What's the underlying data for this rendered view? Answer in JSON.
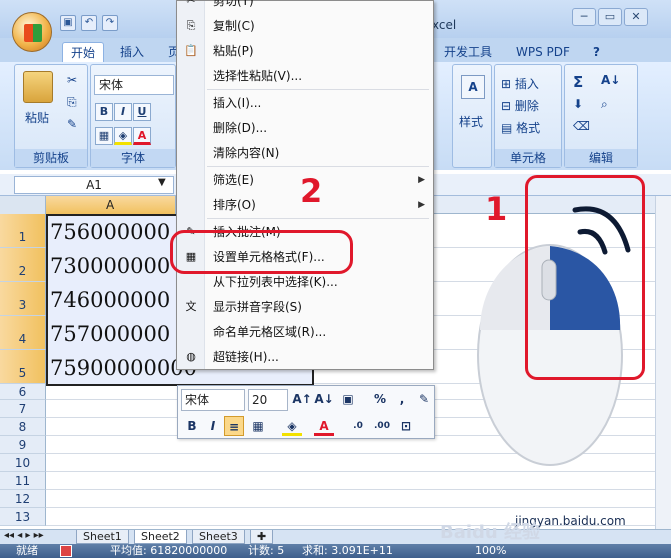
{
  "title": {
    "app_suffix": "xcel"
  },
  "ribbon_tabs": [
    "开始",
    "插入",
    "页",
    "开发工具",
    "WPS PDF"
  ],
  "ribbon": {
    "paste_label": "粘贴",
    "clipboard_group": "剪贴板",
    "font_name": "宋体",
    "font_group": "字体",
    "style_label": "样式",
    "cells": {
      "insert": "插入",
      "delete": "删除",
      "format": "格式",
      "group": "单元格"
    },
    "edit_group": "编辑",
    "bold": "B",
    "italic": "I",
    "underline": "U"
  },
  "namebox": "A1",
  "column_header": "A",
  "rows": [
    "1",
    "2",
    "3",
    "4",
    "5",
    "6",
    "7",
    "8",
    "9",
    "10",
    "11",
    "12",
    "13"
  ],
  "cell_values": [
    "756000000",
    "730000000",
    "746000000",
    "757000000",
    "75900000000"
  ],
  "context_menu": {
    "items": [
      {
        "label": "剪切(T)",
        "icon": "scissors-icon"
      },
      {
        "label": "复制(C)",
        "icon": "copy-icon"
      },
      {
        "label": "粘贴(P)",
        "icon": "paste-icon"
      },
      {
        "label": "选择性粘贴(V)...",
        "icon": ""
      },
      {
        "label": "插入(I)...",
        "icon": ""
      },
      {
        "label": "删除(D)...",
        "icon": ""
      },
      {
        "label": "清除内容(N)",
        "icon": ""
      },
      {
        "label": "筛选(E)",
        "icon": "",
        "submenu": true
      },
      {
        "label": "排序(O)",
        "icon": "",
        "submenu": true
      },
      {
        "label": "插入批注(M)",
        "icon": "comment-icon"
      },
      {
        "label": "设置单元格格式(F)...",
        "icon": "format-cells-icon"
      },
      {
        "label": "从下拉列表中选择(K)...",
        "icon": ""
      },
      {
        "label": "显示拼音字段(S)",
        "icon": "phonetic-icon"
      },
      {
        "label": "命名单元格区域(R)...",
        "icon": ""
      },
      {
        "label": "超链接(H)...",
        "icon": "hyperlink-icon"
      }
    ]
  },
  "mini_toolbar": {
    "font": "宋体",
    "size": "20"
  },
  "annotations": {
    "step1": "1",
    "step2": "2"
  },
  "sheets": [
    "Sheet1",
    "Sheet2",
    "Sheet3"
  ],
  "status": {
    "mode": "就绪",
    "average": "平均值: 61820000000",
    "count": "计数: 5",
    "sum": "求和: 3.091E+11",
    "zoom": "100%"
  },
  "watermark": "Baidu 经验",
  "watermark_url": "jingyan.baidu.com"
}
